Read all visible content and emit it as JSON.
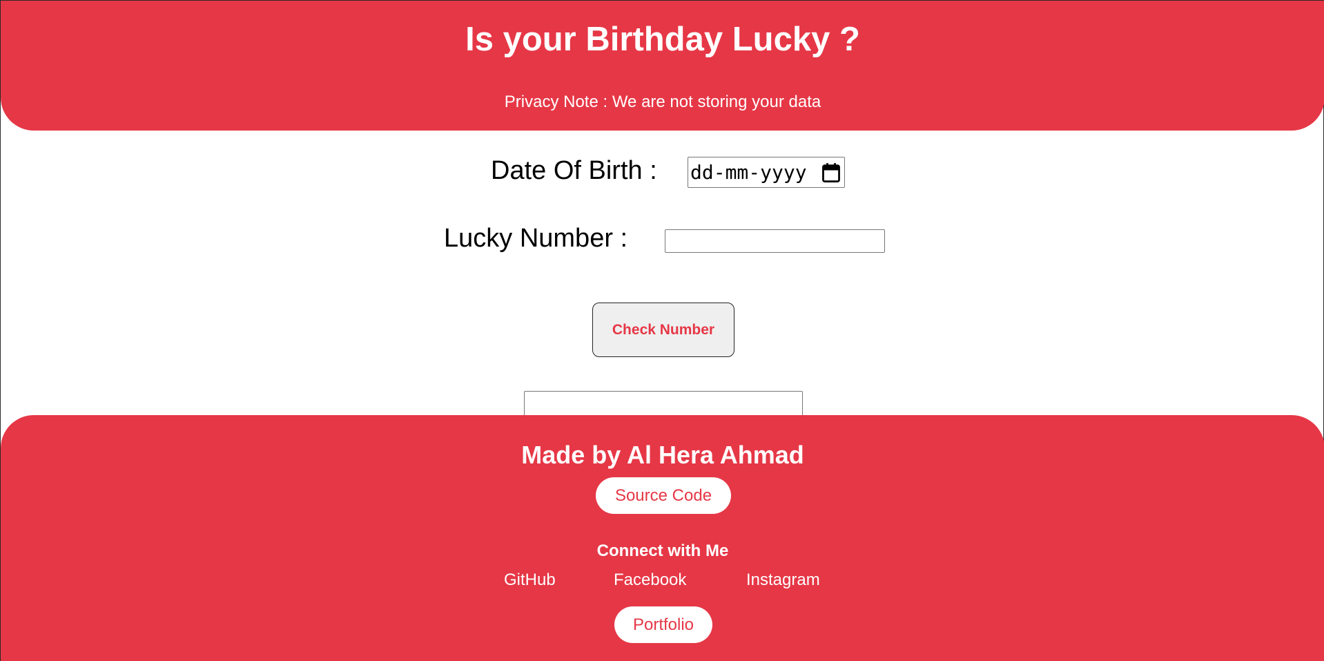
{
  "header": {
    "title": "Is your Birthday Lucky ?",
    "privacy_note": "Privacy Note : We are not storing your data"
  },
  "form": {
    "dob_label": "Date Of Birth :",
    "dob_placeholder": "dd-mm-yyyy",
    "lucky_label": "Lucky Number :",
    "lucky_value": "",
    "check_button": "Check Number",
    "output_value": ""
  },
  "footer": {
    "made_by": "Made by Al Hera Ahmad",
    "source_code": "Source Code",
    "connect_heading": "Connect with Me",
    "links": {
      "github": "GitHub",
      "facebook": "Facebook",
      "instagram": "Instagram"
    },
    "portfolio": "Portfolio"
  },
  "icons": {
    "calendar": "calendar-icon"
  },
  "colors": {
    "accent": "#e63746",
    "button_bg": "#efefef",
    "white": "#ffffff"
  }
}
